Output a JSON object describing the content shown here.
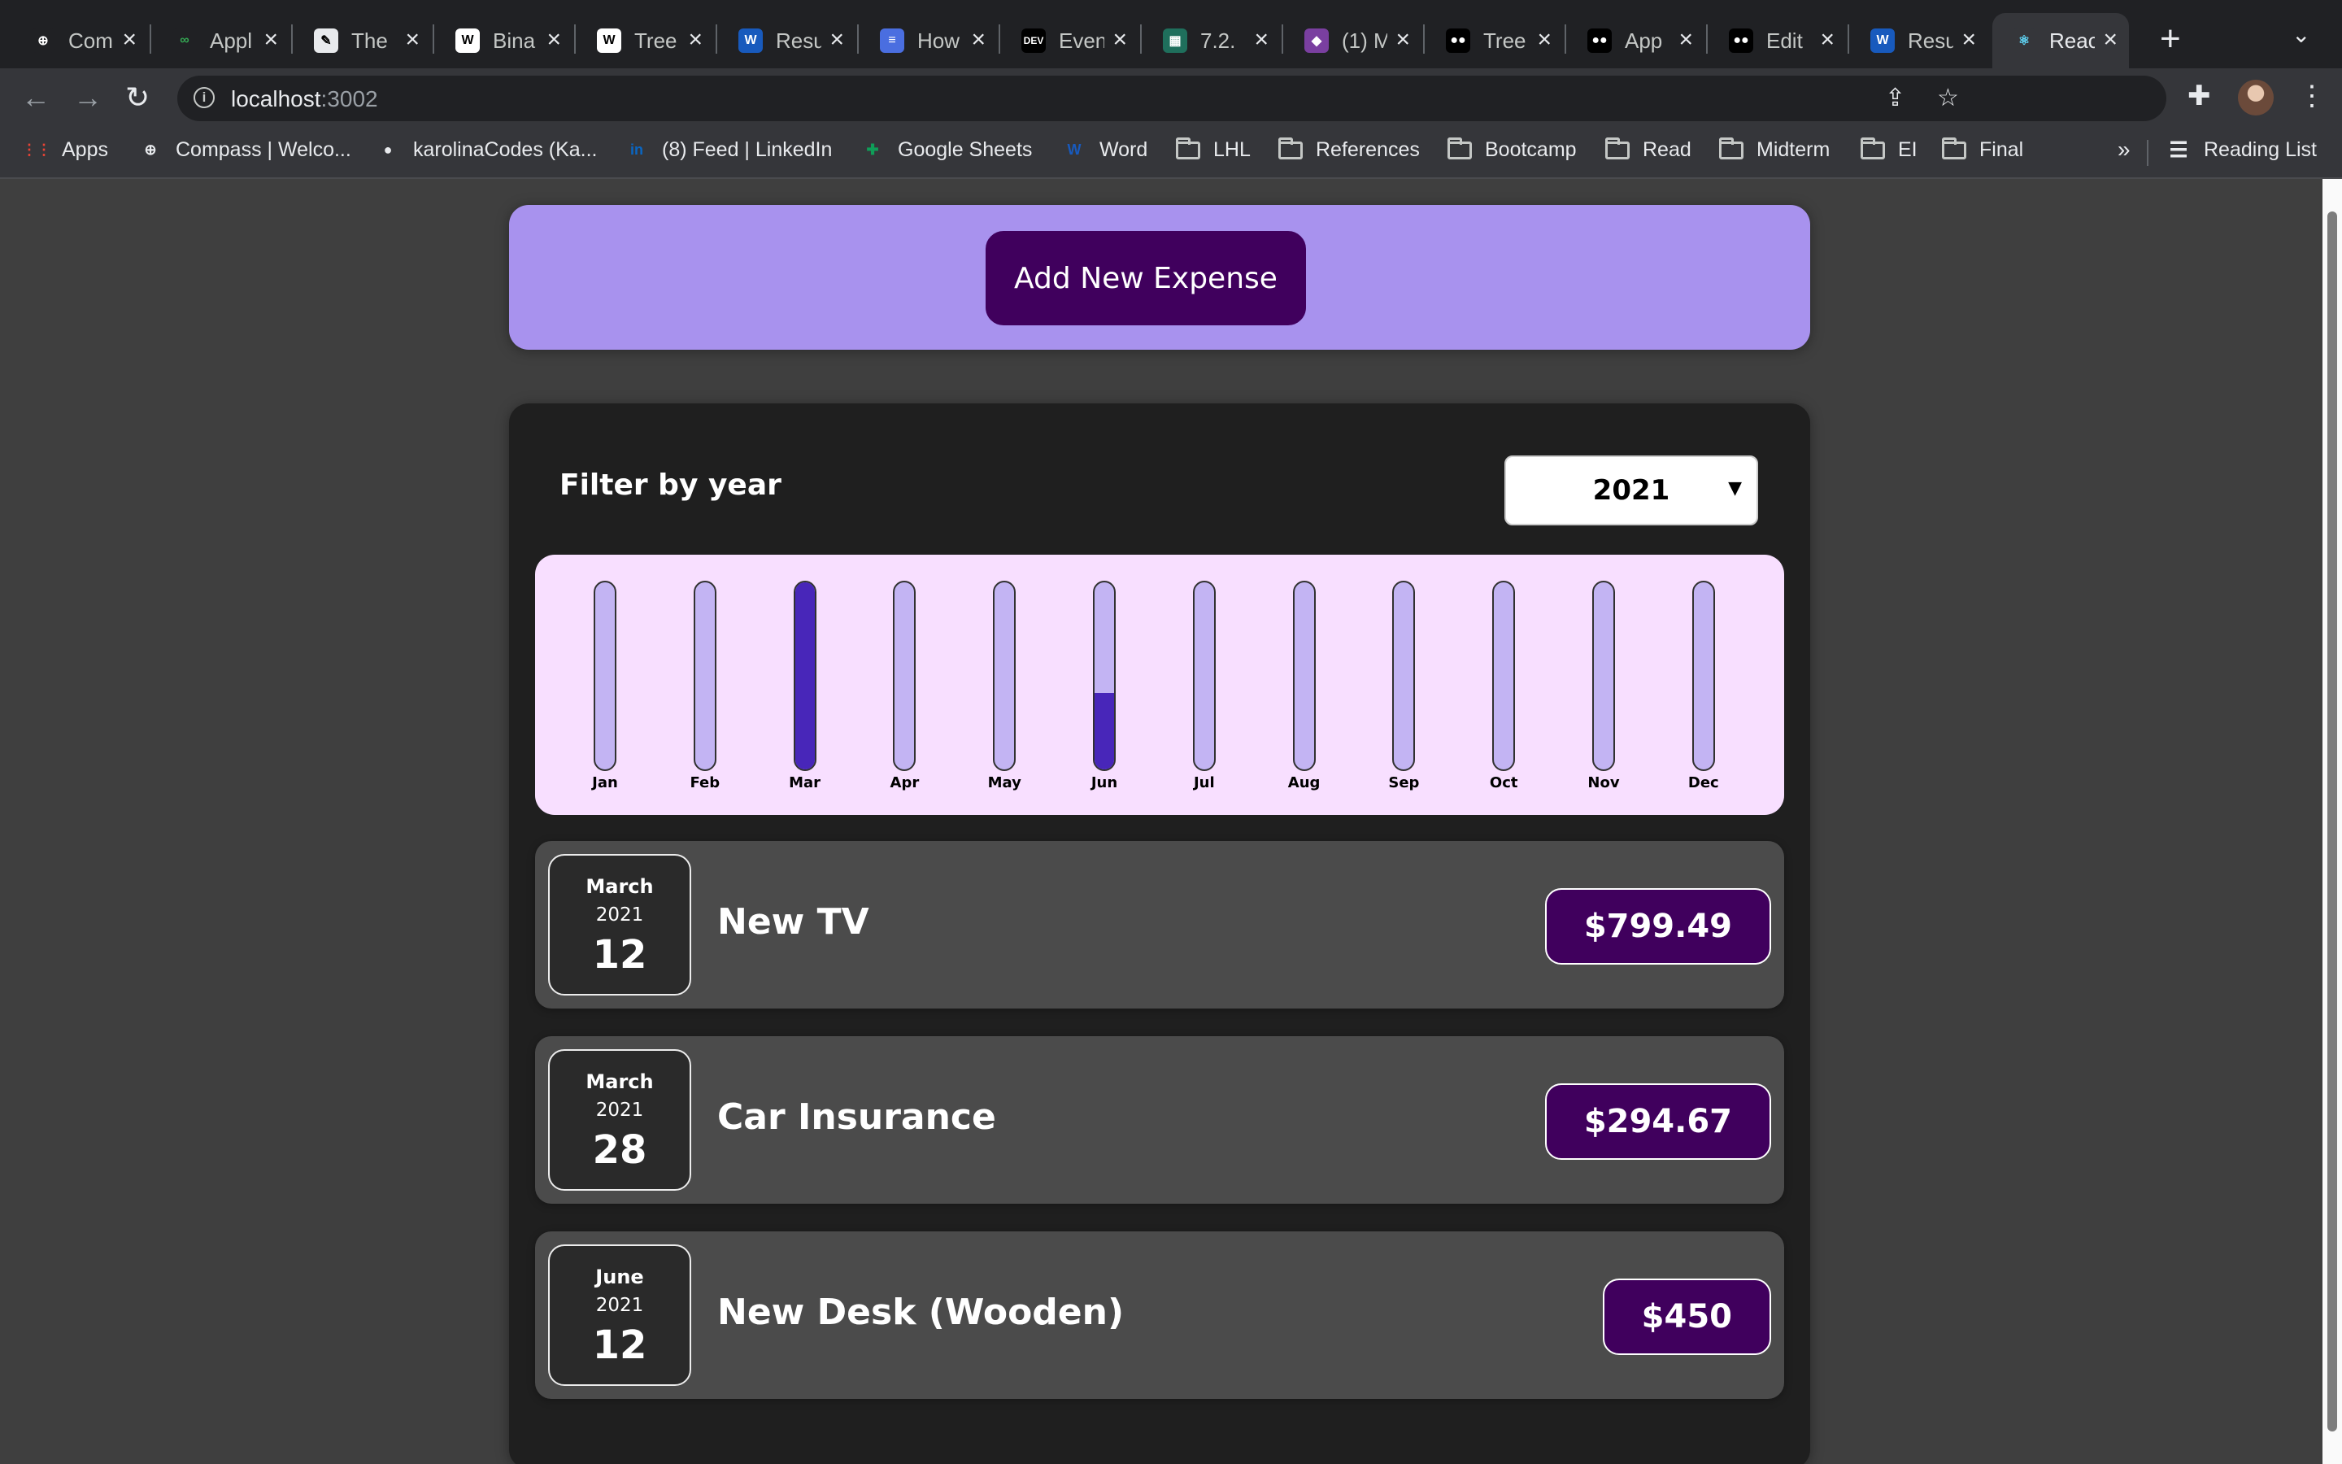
{
  "browser": {
    "tabs": [
      {
        "title": "Com",
        "icon": "compass-icon",
        "fav_bg": "#202124",
        "fav_text": "⊕"
      },
      {
        "title": "Appl",
        "icon": "infinity-icon",
        "fav_bg": "#202124",
        "fav_text": "∞"
      },
      {
        "title": "The",
        "icon": "page-icon",
        "fav_bg": "#e8eaed",
        "fav_text": "✎"
      },
      {
        "title": "Bina",
        "icon": "wikipedia-icon",
        "fav_bg": "#ffffff",
        "fav_text": "W"
      },
      {
        "title": "Tree",
        "icon": "wikipedia-icon",
        "fav_bg": "#ffffff",
        "fav_text": "W"
      },
      {
        "title": "Resu",
        "icon": "word-icon",
        "fav_bg": "#185abd",
        "fav_text": "W"
      },
      {
        "title": "How",
        "icon": "docs-icon",
        "fav_bg": "#4a6ee0",
        "fav_text": "≡"
      },
      {
        "title": "Even",
        "icon": "dev-icon",
        "fav_bg": "#000000",
        "fav_text": "DEV"
      },
      {
        "title": "7.2.",
        "icon": "sheet-icon",
        "fav_bg": "#1f6f5c",
        "fav_text": "▦"
      },
      {
        "title": "(1) M",
        "icon": "image-icon",
        "fav_bg": "#7a3fa0",
        "fav_text": "◆"
      },
      {
        "title": "Tree",
        "icon": "medium-icon",
        "fav_bg": "#000000",
        "fav_text": "●●"
      },
      {
        "title": "App",
        "icon": "medium-icon",
        "fav_bg": "#000000",
        "fav_text": "●●"
      },
      {
        "title": "Edit",
        "icon": "medium-icon",
        "fav_bg": "#000000",
        "fav_text": "●●"
      },
      {
        "title": "Resu",
        "icon": "word-icon",
        "fav_bg": "#185abd",
        "fav_text": "W"
      },
      {
        "title": "Reac",
        "icon": "react-icon",
        "fav_bg": "#35363a",
        "fav_text": "⚛"
      }
    ],
    "url_host": "localhost",
    "url_port": ":3002",
    "bookmarks": [
      {
        "label": "Apps",
        "icon": "apps-grid-icon"
      },
      {
        "label": "Compass | Welco...",
        "icon": "compass-icon"
      },
      {
        "label": "karolinaCodes (Ka...",
        "icon": "github-icon"
      },
      {
        "label": "(8) Feed | LinkedIn",
        "icon": "linkedin-icon"
      },
      {
        "label": "Google Sheets",
        "icon": "sheets-icon"
      },
      {
        "label": "Word",
        "icon": "word-icon"
      },
      {
        "label": "LHL",
        "icon": "folder-icon"
      },
      {
        "label": "References",
        "icon": "folder-icon"
      },
      {
        "label": "Bootcamp",
        "icon": "folder-icon"
      },
      {
        "label": "Read",
        "icon": "folder-icon"
      },
      {
        "label": "Midterm",
        "icon": "folder-icon"
      },
      {
        "label": "EI",
        "icon": "folder-icon"
      },
      {
        "label": "Final",
        "icon": "folder-icon"
      }
    ],
    "bookmarks_more": "»",
    "reading_list": "Reading List"
  },
  "app": {
    "add_button": "Add New Expense",
    "filter_label": "Filter by year",
    "selected_year": "2021",
    "chart_data": {
      "type": "bar",
      "categories": [
        "Jan",
        "Feb",
        "Mar",
        "Apr",
        "May",
        "Jun",
        "Jul",
        "Aug",
        "Sep",
        "Oct",
        "Nov",
        "Dec"
      ],
      "values": [
        0,
        0,
        1094.16,
        0,
        0,
        450,
        0,
        0,
        0,
        0,
        0,
        0
      ],
      "max_value": 1094.16,
      "colors": {
        "empty": "#c3b4f3",
        "fill": "#4826b9",
        "background": "#f8dfff"
      }
    },
    "expenses": [
      {
        "month": "March",
        "year": "2021",
        "day": "12",
        "title": "New TV",
        "amount": "$799.49"
      },
      {
        "month": "March",
        "year": "2021",
        "day": "28",
        "title": "Car Insurance",
        "amount": "$294.67"
      },
      {
        "month": "June",
        "year": "2021",
        "day": "12",
        "title": "New Desk (Wooden)",
        "amount": "$450"
      }
    ]
  }
}
